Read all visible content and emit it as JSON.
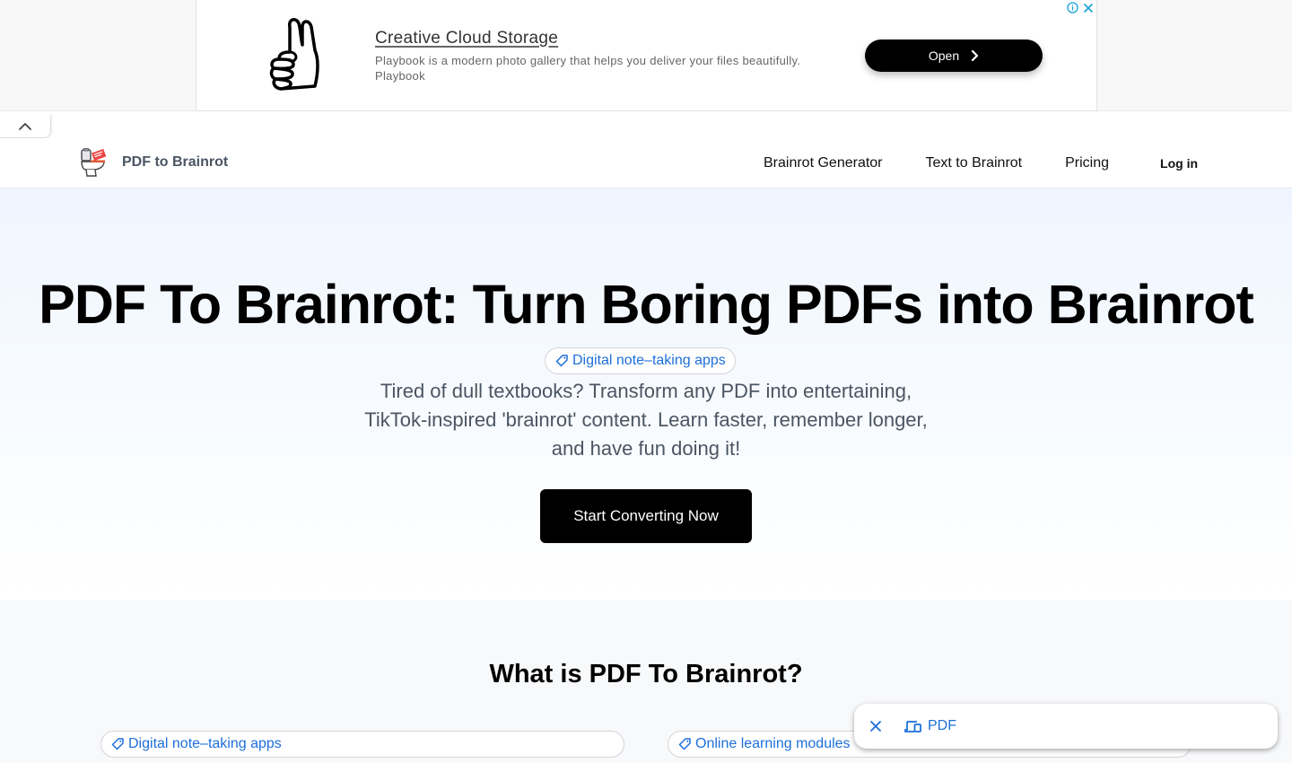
{
  "ad": {
    "title": "Creative Cloud Storage",
    "description": "Playbook is a modern photo gallery that helps you deliver your files beautifully.",
    "advertiser": "Playbook",
    "open_label": "Open",
    "thumbnail_icon": "thumbs-up-icon",
    "info_icon": "info-icon",
    "close_icon": "close-icon",
    "accent_color": "#1aa3d9"
  },
  "navbar": {
    "brand_name": "PDF to Brainrot",
    "logo_icon": "toilet-logo-icon",
    "links": [
      {
        "label": "Brainrot Generator"
      },
      {
        "label": "Text to Brainrot"
      },
      {
        "label": "Pricing"
      }
    ],
    "login_label": "Log in"
  },
  "hero": {
    "title": "PDF To Brainrot: Turn Boring PDFs into Brainrot",
    "tag": "Digital note–taking apps",
    "subtitle_lines": [
      "Tired of dull textbooks? Transform any PDF into entertaining,",
      "TikTok-inspired 'brainrot' content. Learn faster, remember longer,",
      "and have fun doing it!"
    ],
    "cta_label": "Start Converting Now"
  },
  "what_is": {
    "title": "What is PDF To Brainrot?",
    "tags": [
      {
        "label": "Digital note–taking apps"
      },
      {
        "label": "Online learning modules"
      }
    ]
  },
  "pdf_bar": {
    "label": "PDF",
    "close_icon": "close-icon",
    "device_icon": "devices-icon"
  },
  "colors": {
    "link_blue": "#1d6fd9",
    "hero_bg_top": "#eff6ff",
    "cta_bg": "#000000",
    "subtitle_gray": "#4b5563"
  }
}
